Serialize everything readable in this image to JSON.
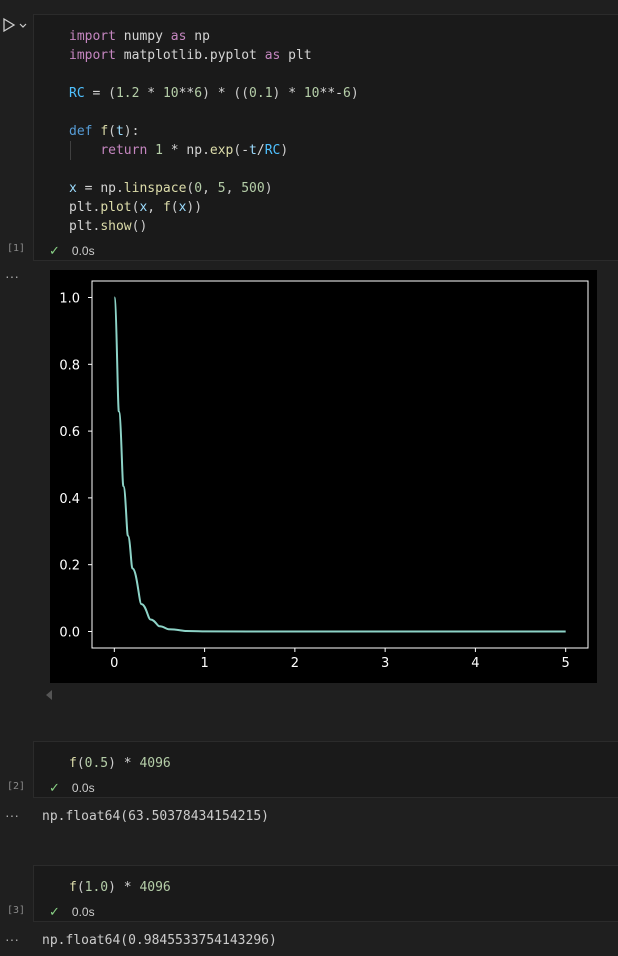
{
  "run_icon": "play-icon",
  "run_menu_icon": "chevron-down-icon",
  "cells": [
    {
      "exec_count": "[1]",
      "status_time": "0.0s",
      "code_lines": [
        "import numpy as np",
        "import matplotlib.pyplot as plt",
        "",
        "RC = (1.2 * 10**6) * ((0.1) * 10**-6)",
        "",
        "def f(t):",
        "    return 1 * np.exp(-t/RC)",
        "",
        "x = np.linspace(0, 5, 500)",
        "plt.plot(x, f(x))",
        "plt.show()"
      ],
      "output_ellipsis": "···"
    },
    {
      "exec_count": "[2]",
      "status_time": "0.0s",
      "code_lines": [
        "f(0.5) * 4096"
      ],
      "output_ellipsis": "···",
      "output_text": "np.float64(63.50378434154215)"
    },
    {
      "exec_count": "[3]",
      "status_time": "0.0s",
      "code_lines": [
        "f(1.0) * 4096"
      ],
      "output_ellipsis": "···",
      "output_text": "np.float64(0.9845533754143296)"
    }
  ],
  "colors": {
    "line": "#8dd3c7",
    "background": "#1f1f1f",
    "plot_background": "#000000",
    "check": "#89d185"
  },
  "chart_data": {
    "type": "line",
    "title": "",
    "xlabel": "",
    "ylabel": "",
    "xlim": [
      0,
      5
    ],
    "ylim": [
      0,
      1
    ],
    "xticks": [
      0,
      1,
      2,
      3,
      4,
      5
    ],
    "yticks": [
      0.0,
      0.2,
      0.4,
      0.6,
      0.8,
      1.0
    ],
    "xtick_labels": [
      "0",
      "1",
      "2",
      "3",
      "4",
      "5"
    ],
    "ytick_labels": [
      "0.0",
      "0.2",
      "0.4",
      "0.6",
      "0.8",
      "1.0"
    ],
    "grid": false,
    "series": [
      {
        "x": [
          0,
          0.05,
          0.1,
          0.15,
          0.2,
          0.3,
          0.4,
          0.5,
          0.6,
          0.8,
          1.0,
          1.5,
          2,
          3,
          4,
          5
        ],
        "values": [
          1.0,
          0.659,
          0.435,
          0.287,
          0.189,
          0.082,
          0.036,
          0.0155,
          0.0067,
          0.0013,
          0.0002,
          0.0,
          0.0,
          0.0,
          0.0,
          0.0
        ]
      }
    ]
  }
}
